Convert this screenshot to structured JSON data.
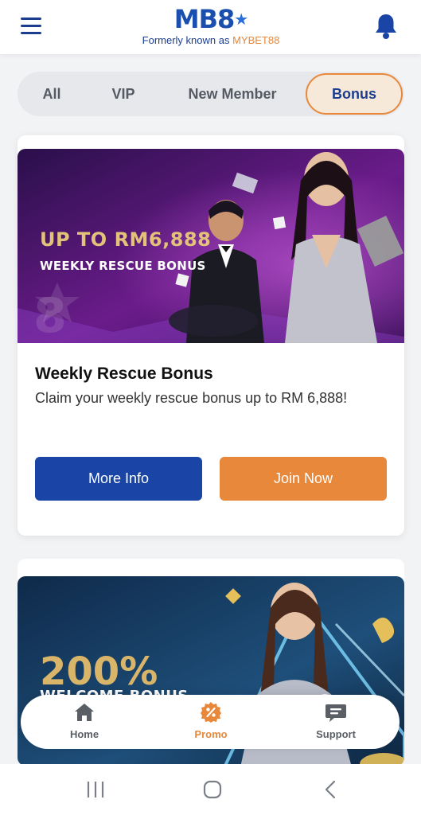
{
  "header": {
    "brand": "MB8",
    "tagline_prefix": "Formerly known as ",
    "tagline_accent": "MYBET88",
    "menu_icon": "hamburger-menu-icon",
    "bell_icon": "bell-icon"
  },
  "filter_tabs": [
    {
      "label": "All",
      "active": false
    },
    {
      "label": "VIP",
      "active": false
    },
    {
      "label": "New Member",
      "active": false
    },
    {
      "label": "Bonus",
      "active": true
    }
  ],
  "promos": [
    {
      "banner_headline": "UP TO RM6,888",
      "banner_subtitle": "WEEKLY RESCUE BONUS",
      "title": "Weekly Rescue Bonus",
      "description": "Claim your weekly rescue bonus up to RM 6,888!",
      "more_info_label": "More Info",
      "join_label": "Join Now"
    },
    {
      "banner_headline": "200%",
      "banner_subtitle": "WELCOME BONUS"
    }
  ],
  "bottom_nav": [
    {
      "label": "Home",
      "icon": "home-icon",
      "active": false
    },
    {
      "label": "Promo",
      "icon": "promo-percent-icon",
      "active": true
    },
    {
      "label": "Support",
      "icon": "chat-support-icon",
      "active": false
    }
  ],
  "colors": {
    "primary_blue": "#1a45a6",
    "accent_orange": "#e8883a",
    "active_tab_bg": "#f6e9da"
  }
}
